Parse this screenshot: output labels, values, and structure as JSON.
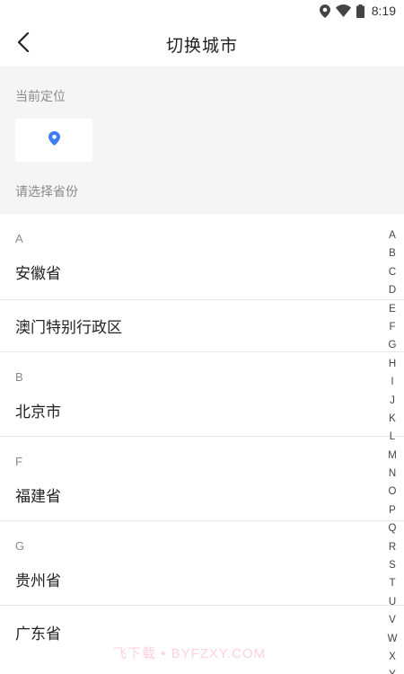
{
  "status_bar": {
    "time": "8:19",
    "icons": [
      "location-icon",
      "wifi-icon",
      "battery-icon"
    ]
  },
  "header": {
    "back_icon": "back-arrow-icon",
    "title": "切换城市"
  },
  "location": {
    "current_label": "当前定位",
    "pin_icon": "location-pin-icon",
    "pin_color": "#3d7cf5",
    "choose_label": "请选择省份"
  },
  "list": {
    "groups": [
      {
        "letter": "A",
        "items": [
          "安徽省",
          "澳门特别行政区"
        ]
      },
      {
        "letter": "B",
        "items": [
          "北京市"
        ]
      },
      {
        "letter": "F",
        "items": [
          "福建省"
        ]
      },
      {
        "letter": "G",
        "items": [
          "贵州省",
          "广东省"
        ]
      }
    ]
  },
  "index_bar": [
    "A",
    "B",
    "C",
    "D",
    "E",
    "F",
    "G",
    "H",
    "I",
    "J",
    "K",
    "L",
    "M",
    "N",
    "O",
    "P",
    "Q",
    "R",
    "S",
    "T",
    "U",
    "V",
    "W",
    "X",
    "Y"
  ],
  "watermark": "飞下载 • BYFZXY.COM"
}
